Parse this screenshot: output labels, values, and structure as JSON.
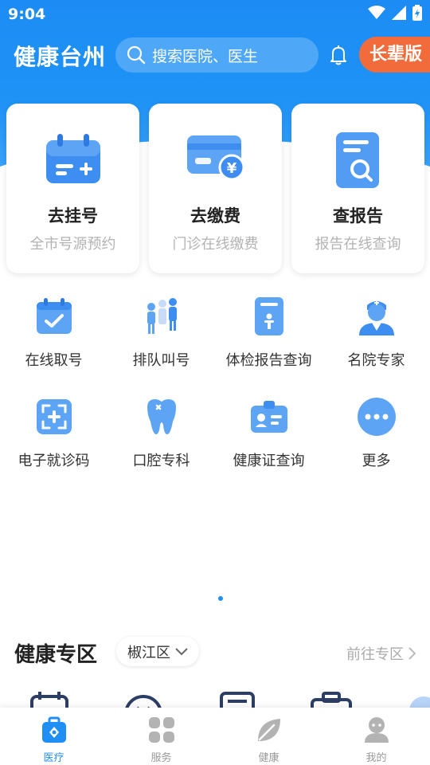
{
  "status_bar": {
    "time": "9:04"
  },
  "header": {
    "app_title": "健康台州",
    "search_placeholder": "搜索医院、医生",
    "elder_mode_label": "长辈版"
  },
  "cards": [
    {
      "title": "去挂号",
      "subtitle": "全市号源预约",
      "icon": "calendar-plus-icon"
    },
    {
      "title": "去缴费",
      "subtitle": "门诊在线缴费",
      "icon": "card-yuan-icon"
    },
    {
      "title": "查报告",
      "subtitle": "报告在线查询",
      "icon": "report-search-icon"
    }
  ],
  "services": [
    {
      "label": "在线取号",
      "icon": "calendar-check-icon"
    },
    {
      "label": "排队叫号",
      "icon": "queue-people-icon"
    },
    {
      "label": "体检报告查询",
      "icon": "checkup-report-icon"
    },
    {
      "label": "名院专家",
      "icon": "doctor-icon"
    },
    {
      "label": "电子就诊码",
      "icon": "scan-code-icon"
    },
    {
      "label": "口腔专科",
      "icon": "tooth-icon"
    },
    {
      "label": "健康证查询",
      "icon": "health-cert-icon"
    },
    {
      "label": "更多",
      "icon": "more-icon"
    }
  ],
  "health_zone": {
    "title": "健康专区",
    "district": "椒江区",
    "link_label": "前往专区"
  },
  "tabs": [
    {
      "label": "医疗",
      "icon": "medical-kit-icon",
      "active": true
    },
    {
      "label": "服务",
      "icon": "grid-icon",
      "active": false
    },
    {
      "label": "健康",
      "icon": "leaf-icon",
      "active": false
    },
    {
      "label": "我的",
      "icon": "profile-icon",
      "active": false
    }
  ],
  "colors": {
    "primary": "#1f8ef5",
    "accent_orange": "#f26b3a",
    "muted_text": "#b3b3b3"
  }
}
